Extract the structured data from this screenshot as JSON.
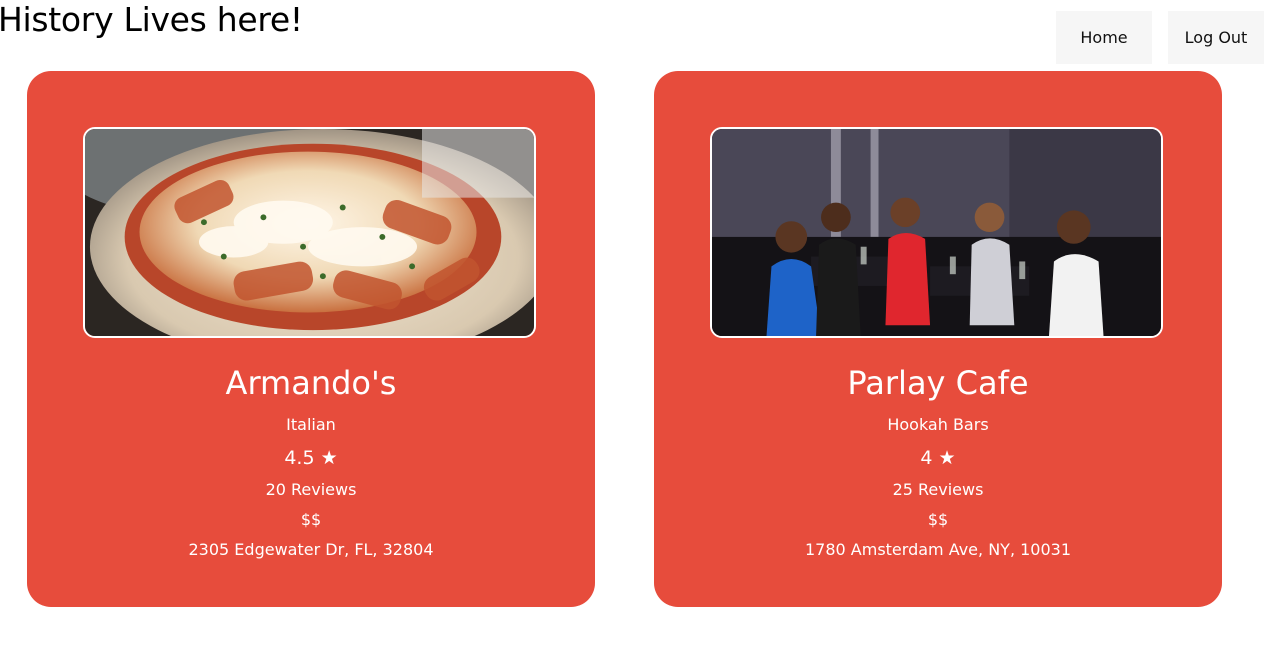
{
  "header": {
    "title": "History Lives here!"
  },
  "nav": {
    "home_label": "Home",
    "logout_label": "Log Out"
  },
  "colors": {
    "card_background": "#e74c3c",
    "card_text": "#ffffff",
    "nav_background": "#f6f6f6"
  },
  "cards": [
    {
      "name": "Armando's",
      "category": "Italian",
      "rating": "4.5 ★",
      "reviews": "20 Reviews",
      "price": "$$",
      "address": "2305 Edgewater Dr, FL, 32804",
      "photo_icon": "baked-pasta-photo"
    },
    {
      "name": "Parlay Cafe",
      "category": "Hookah Bars",
      "rating": "4 ★",
      "reviews": "25 Reviews",
      "price": "$$",
      "address": "1780 Amsterdam Ave, NY, 10031",
      "photo_icon": "people-at-bar-photo"
    }
  ]
}
